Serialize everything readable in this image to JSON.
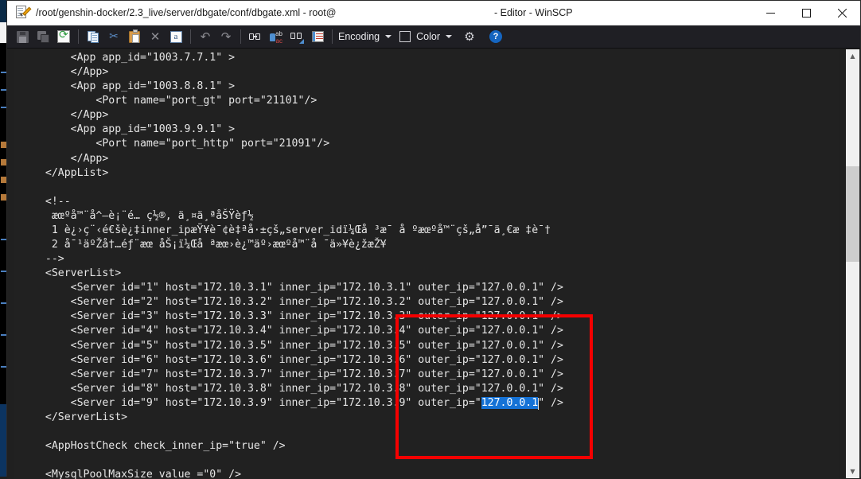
{
  "window": {
    "title_path": "/root/genshin-docker/2.3_live/server/dbgate/conf/dbgate.xml - root@",
    "title_app": "- Editor - WinSCP",
    "icon": "edit-file-icon",
    "minimize_label": "─",
    "maximize_label": "□",
    "close_label": "✕"
  },
  "toolbar": {
    "items": [
      {
        "name": "save-button",
        "icon": "save-icon"
      },
      {
        "name": "save-as-button",
        "icon": "save-all-icon"
      },
      {
        "name": "reload-button",
        "icon": "reload-icon"
      },
      {
        "name": "copy-button",
        "icon": "copy-icon"
      },
      {
        "name": "cut-button",
        "icon": "scissors-icon"
      },
      {
        "name": "paste-button",
        "icon": "clipboard-icon"
      },
      {
        "name": "delete-button",
        "icon": "close-x-icon"
      },
      {
        "name": "select-all-button",
        "icon": "letter-a-icon"
      },
      {
        "name": "undo-button",
        "icon": "undo-arrow-icon"
      },
      {
        "name": "redo-button",
        "icon": "redo-arrow-icon"
      },
      {
        "name": "find-button",
        "icon": "binoculars-icon"
      },
      {
        "name": "replace-button",
        "icon": "replace-ab-ac-icon"
      },
      {
        "name": "find-next-button",
        "icon": "find-next-icon"
      },
      {
        "name": "go-to-line-button",
        "icon": "list-lines-icon"
      }
    ],
    "encoding_label": "Encoding",
    "color_label": "Color",
    "preferences_icon": "gear-icon",
    "help_icon": "question-mark-icon",
    "encoding_caret": "▾",
    "color_caret": "▾"
  },
  "editor": {
    "font": "monospace",
    "selection_color": "#1572d6",
    "background": "#212121",
    "foreground": "#e6e6e6",
    "lines": [
      "      <App app_id=\"1003.7.7.1\" >",
      "      </App>",
      "      <App app_id=\"1003.8.8.1\" >",
      "          <Port name=\"port_gt\" port=\"21101\"/>",
      "      </App>",
      "      <App app_id=\"1003.9.9.1\" >",
      "          <Port name=\"port_http\" port=\"21091\"/>",
      "      </App>",
      "  </AppList>",
      "",
      "  <!--",
      "   æœºå™¨å^—è¡¨é… ç½®, ä¸¤ä¸ªåŠŸèƒ½",
      "   1 è¿›ç¨‹é€šè¿‡inner_ipæŸ¥è¯¢è‡ªå·±çš„server_idï¼Œå ³æ¯ å ºæœºå™¨çš„å”¯ä¸€æ ‡è¯†",
      "   2 å¯¹äºŽå†…éƒ¨æœ åŠ¡ï¼Œå ªæœ›è¿™äº›æœºå™¨å ¯ä»¥è¿žæŽ¥",
      "  -->",
      "  <ServerList>",
      "      <Server id=\"1\" host=\"172.10.3.1\" inner_ip=\"172.10.3.1\" outer_ip=\"127.0.0.1\" />",
      "      <Server id=\"2\" host=\"172.10.3.2\" inner_ip=\"172.10.3.2\" outer_ip=\"127.0.0.1\" />",
      "      <Server id=\"3\" host=\"172.10.3.3\" inner_ip=\"172.10.3.3\" outer_ip=\"127.0.0.1\" />",
      "      <Server id=\"4\" host=\"172.10.3.4\" inner_ip=\"172.10.3.4\" outer_ip=\"127.0.0.1\" />",
      "      <Server id=\"5\" host=\"172.10.3.5\" inner_ip=\"172.10.3.5\" outer_ip=\"127.0.0.1\" />",
      "      <Server id=\"6\" host=\"172.10.3.6\" inner_ip=\"172.10.3.6\" outer_ip=\"127.0.0.1\" />",
      "      <Server id=\"7\" host=\"172.10.3.7\" inner_ip=\"172.10.3.7\" outer_ip=\"127.0.0.1\" />",
      "      <Server id=\"8\" host=\"172.10.3.8\" inner_ip=\"172.10.3.8\" outer_ip=\"127.0.0.1\" />",
      "      <Server id=\"9\" host=\"172.10.3.9\" inner_ip=\"172.10.3.9\" outer_ip=\"127.0.0.1\" />",
      "  </ServerList>",
      "",
      "  <AppHostCheck check_inner_ip=\"true\" />",
      "",
      "  <MysqlPoolMaxSize value =\"0\" />"
    ],
    "selection": {
      "line_index": 24,
      "text": "127.0.0.1",
      "prefix": "      <Server id=\"9\" host=\"172.10.3.9\" inner_ip=\"172.10.3.9\" outer_ip=\"",
      "suffix": "\" />"
    }
  },
  "annotation": {
    "name": "red-highlight-box",
    "color": "#f50000",
    "covers": "outer_ip attribute column for servers 1-9"
  },
  "scrollbar": {
    "up_arrow": "▲",
    "down_arrow": "▼"
  }
}
